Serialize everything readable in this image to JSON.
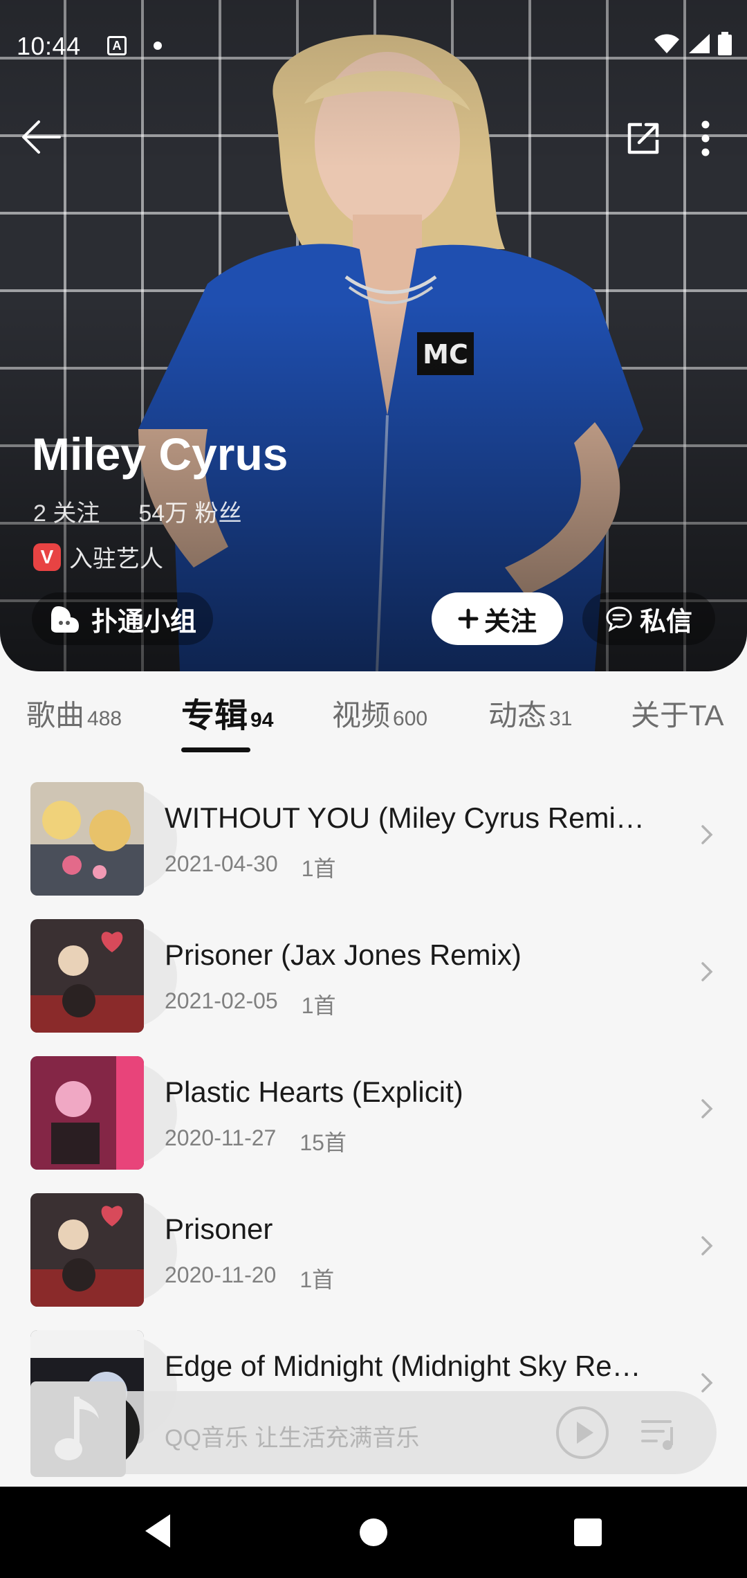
{
  "status_bar": {
    "time": "10:44",
    "notif_letter": "A"
  },
  "header": {
    "back_icon": "arrow-left-icon",
    "share_icon": "share-out-icon",
    "more_icon": "more-vertical-icon"
  },
  "artist": {
    "name": "Miley Cyrus",
    "following": "2 关注",
    "fans": "54万 粉丝",
    "verified_badge": "V",
    "verified_label": "入驻艺人",
    "group_button": "扑通小组",
    "follow_button": "关注",
    "message_button": "私信"
  },
  "tabs": [
    {
      "label": "歌曲",
      "count": "488"
    },
    {
      "label": "专辑",
      "count": "94"
    },
    {
      "label": "视频",
      "count": "600"
    },
    {
      "label": "动态",
      "count": "31"
    },
    {
      "label": "关于TA",
      "count": ""
    }
  ],
  "active_tab": "专辑",
  "albums": [
    {
      "title": "WITHOUT YOU (Miley Cyrus Remix…",
      "date": "2021-04-30",
      "tracks": "1首"
    },
    {
      "title": "Prisoner (Jax Jones Remix)",
      "date": "2021-02-05",
      "tracks": "1首"
    },
    {
      "title": "Plastic Hearts (Explicit)",
      "date": "2020-11-27",
      "tracks": "15首"
    },
    {
      "title": "Prisoner",
      "date": "2020-11-20",
      "tracks": "1首"
    },
    {
      "title": "Edge of Midnight (Midnight Sky Re…",
      "date": "",
      "tracks": ""
    }
  ],
  "player": {
    "placeholder": "QQ音乐 让生活充满音乐"
  },
  "colors": {
    "accent_red": "#e84343",
    "background": "#f6f6f6",
    "hero_bg": "#2b2d33"
  }
}
